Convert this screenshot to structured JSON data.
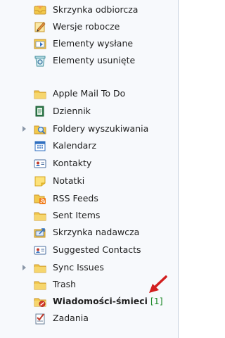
{
  "folders": [
    {
      "label": "Skrzynka odbiorcza",
      "icon": "inbox-icon"
    },
    {
      "label": "Wersje robocze",
      "icon": "drafts-icon"
    },
    {
      "label": "Elementy wysłane",
      "icon": "sent-items-icon"
    },
    {
      "label": "Elementy usunięte",
      "icon": "deleted-items-icon"
    },
    {
      "label": "Apple Mail To Do",
      "icon": "folder-icon"
    },
    {
      "label": "Dziennik",
      "icon": "journal-icon"
    },
    {
      "label": "Foldery wyszukiwania",
      "icon": "search-folder-icon",
      "expandable": true
    },
    {
      "label": "Kalendarz",
      "icon": "calendar-icon"
    },
    {
      "label": "Kontakty",
      "icon": "contacts-icon"
    },
    {
      "label": "Notatki",
      "icon": "notes-icon"
    },
    {
      "label": "RSS Feeds",
      "icon": "rss-icon"
    },
    {
      "label": "Sent Items",
      "icon": "folder-icon"
    },
    {
      "label": "Skrzynka nadawcza",
      "icon": "outbox-icon"
    },
    {
      "label": "Suggested Contacts",
      "icon": "contacts-icon"
    },
    {
      "label": "Sync Issues",
      "icon": "folder-icon",
      "expandable": true
    },
    {
      "label": "Trash",
      "icon": "folder-icon"
    },
    {
      "label": "Wiadomości-śmieci",
      "icon": "junk-folder-icon",
      "bold": true,
      "count": "[1]"
    },
    {
      "label": "Zadania",
      "icon": "tasks-icon"
    }
  ],
  "colors": {
    "folder": "#f2c94c",
    "accent": "#2f6fc0",
    "count": "#1e8a2a",
    "annotation_arrow": "#d21f1f"
  }
}
